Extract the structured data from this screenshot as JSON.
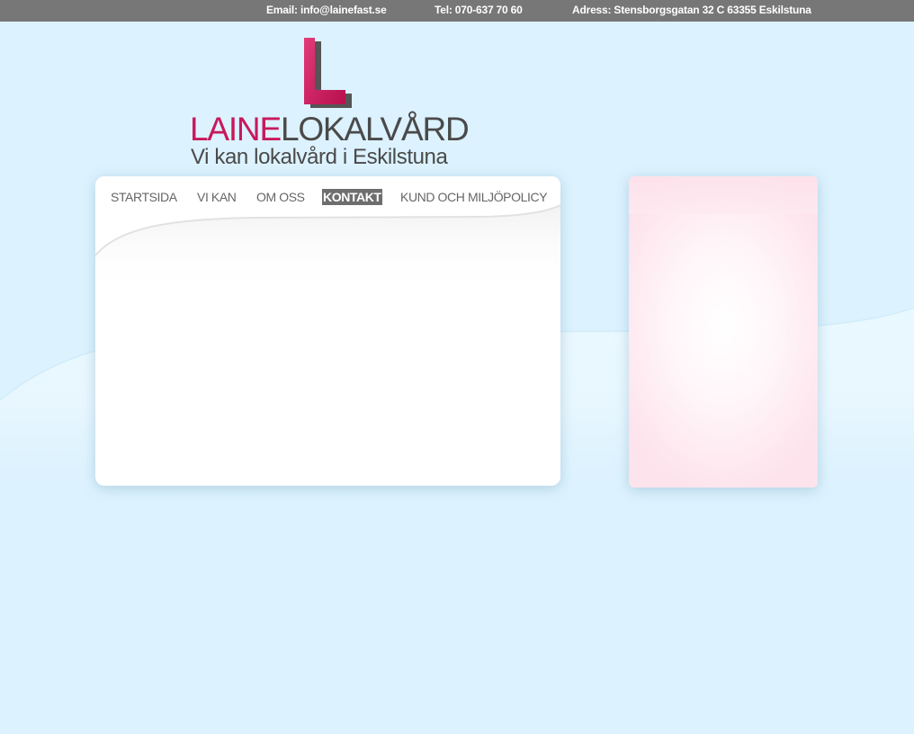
{
  "header": {
    "email": "Email: info@lainefast.se",
    "tel": "Tel: 070-637 70 60",
    "address": "Adress: Stensborgsgatan 32 C 63355 Eskilstuna"
  },
  "logo": {
    "word_1": "LAINE",
    "word_2": "LOKALVÅRD",
    "tagline": "Vi kan lokalvård i Eskilstuna"
  },
  "nav": {
    "items": [
      {
        "label": "STARTSIDA"
      },
      {
        "label": "VI KAN"
      },
      {
        "label": "OM OSS"
      },
      {
        "label": "KONTAKT",
        "active": true
      },
      {
        "label": "KUND OCH MILJÖPOLICY"
      }
    ]
  },
  "colors": {
    "brand_pink": "#c8185c",
    "brand_grey": "#4a4a4a",
    "topbar": "#777777",
    "background": "#dcf2fe",
    "nav_active_bg": "#6e6e6e"
  }
}
